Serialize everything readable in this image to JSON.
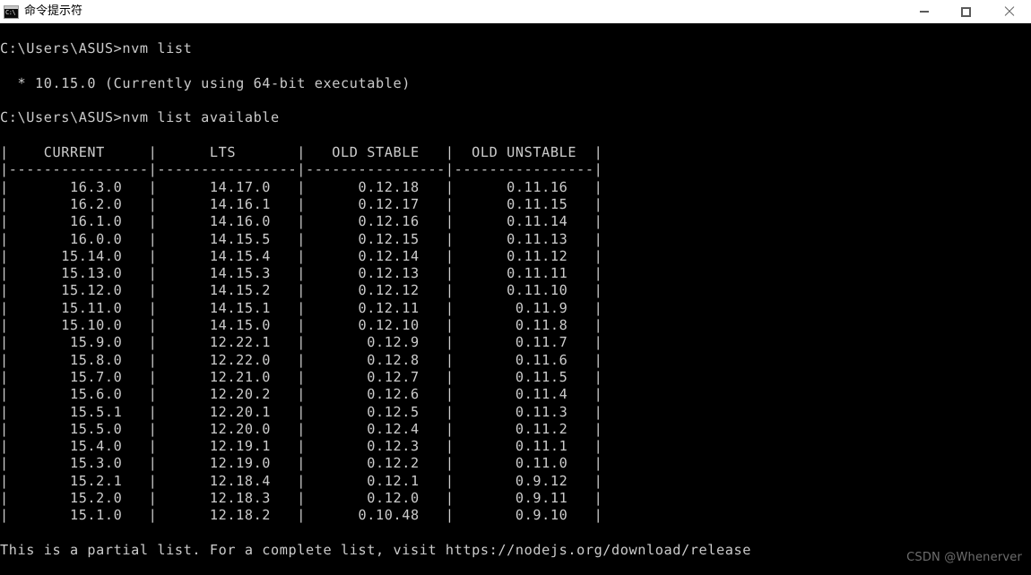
{
  "window": {
    "title": "命令提示符",
    "icon": "command-prompt-icon",
    "icon_glyph": "C:\\",
    "background": "#000000",
    "titlebar_background": "#ffffff",
    "text_color": "#cccccc",
    "controls": [
      {
        "name": "minimize",
        "label": "—"
      },
      {
        "name": "maximize",
        "label": "☐"
      },
      {
        "name": "close",
        "label": "✕"
      }
    ]
  },
  "console": {
    "prompt": "C:\\Users\\ASUS>",
    "commands": [
      "nvm list",
      "nvm list available"
    ],
    "nvm_list_output": "  * 10.15.0 (Currently using 64-bit executable)",
    "footer": "This is a partial list. For a complete list, visit https://nodejs.org/download/release",
    "table": {
      "headers": [
        "CURRENT",
        "LTS",
        "OLD STABLE",
        "OLD UNSTABLE"
      ],
      "separator": "|----------------|----------------|----------------|----------------|",
      "rows": [
        [
          "16.3.0",
          "14.17.0",
          "0.12.18",
          "0.11.16"
        ],
        [
          "16.2.0",
          "14.16.1",
          "0.12.17",
          "0.11.15"
        ],
        [
          "16.1.0",
          "14.16.0",
          "0.12.16",
          "0.11.14"
        ],
        [
          "16.0.0",
          "14.15.5",
          "0.12.15",
          "0.11.13"
        ],
        [
          "15.14.0",
          "14.15.4",
          "0.12.14",
          "0.11.12"
        ],
        [
          "15.13.0",
          "14.15.3",
          "0.12.13",
          "0.11.11"
        ],
        [
          "15.12.0",
          "14.15.2",
          "0.12.12",
          "0.11.10"
        ],
        [
          "15.11.0",
          "14.15.1",
          "0.12.11",
          "0.11.9"
        ],
        [
          "15.10.0",
          "14.15.0",
          "0.12.10",
          "0.11.8"
        ],
        [
          "15.9.0",
          "12.22.1",
          "0.12.9",
          "0.11.7"
        ],
        [
          "15.8.0",
          "12.22.0",
          "0.12.8",
          "0.11.6"
        ],
        [
          "15.7.0",
          "12.21.0",
          "0.12.7",
          "0.11.5"
        ],
        [
          "15.6.0",
          "12.20.2",
          "0.12.6",
          "0.11.4"
        ],
        [
          "15.5.1",
          "12.20.1",
          "0.12.5",
          "0.11.3"
        ],
        [
          "15.5.0",
          "12.20.0",
          "0.12.4",
          "0.11.2"
        ],
        [
          "15.4.0",
          "12.19.1",
          "0.12.3",
          "0.11.1"
        ],
        [
          "15.3.0",
          "12.19.0",
          "0.12.2",
          "0.11.0"
        ],
        [
          "15.2.1",
          "12.18.4",
          "0.12.1",
          "0.9.12"
        ],
        [
          "15.2.0",
          "12.18.3",
          "0.12.0",
          "0.9.11"
        ],
        [
          "15.1.0",
          "12.18.2",
          "0.10.48",
          "0.9.10"
        ]
      ]
    }
  },
  "watermark": {
    "text": "CSDN @Whenerver"
  }
}
